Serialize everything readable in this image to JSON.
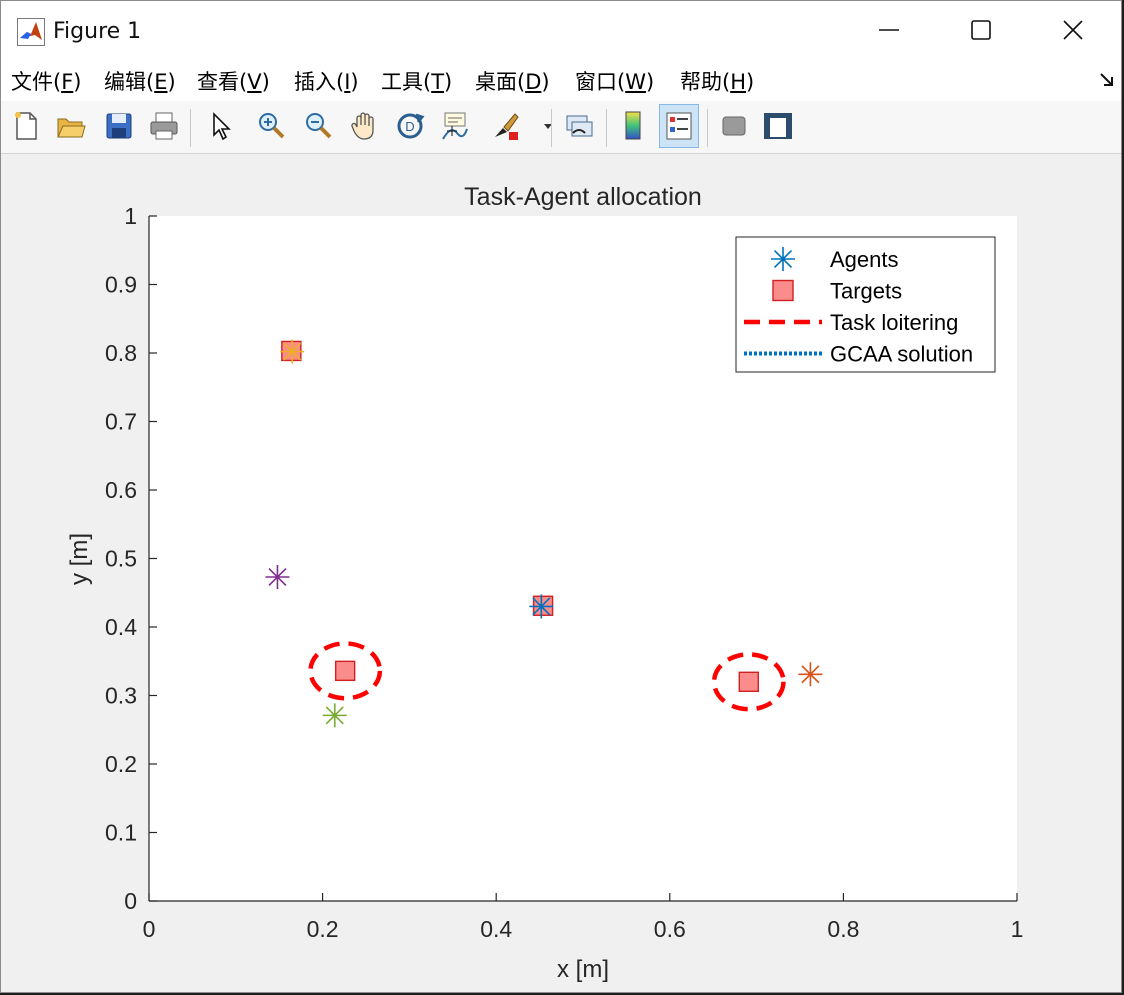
{
  "window": {
    "title": "Figure 1",
    "icon": "matlab-icon"
  },
  "controls": {
    "minimize_icon": "minimize-icon",
    "maximize_icon": "maximize-icon",
    "close_icon": "close-icon"
  },
  "menu": {
    "items": [
      "文件(F)",
      "编辑(E)",
      "查看(V)",
      "插入(I)",
      "工具(T)",
      "桌面(D)",
      "窗口(W)",
      "帮助(H)"
    ],
    "mnemonics": [
      "F",
      "E",
      "V",
      "I",
      "T",
      "D",
      "W",
      "H"
    ],
    "corner_icon": "dock-arrow-icon"
  },
  "toolbar": {
    "buttons": [
      "new-figure-icon",
      "open-file-icon",
      "save-icon",
      "print-icon",
      "pointer-icon",
      "zoom-in-icon",
      "zoom-out-icon",
      "pan-icon",
      "rotate-3d-icon",
      "data-cursor-icon",
      "brush-icon",
      "brush-dropdown-icon",
      "link-plot-icon",
      "colorbar-icon",
      "legend-icon",
      "hide-plot-tools-icon",
      "show-plot-tools-icon"
    ],
    "active": "legend-icon"
  },
  "chart_data": {
    "type": "scatter",
    "title": "Task-Agent allocation",
    "xlabel": "x [m]",
    "ylabel": "y [m]",
    "xlim": [
      0,
      1
    ],
    "ylim": [
      0,
      1
    ],
    "xticks": [
      "0",
      "0.2",
      "0.4",
      "0.6",
      "0.8",
      "1"
    ],
    "yticks": [
      "0",
      "0.1",
      "0.2",
      "0.3",
      "0.4",
      "0.5",
      "0.6",
      "0.7",
      "0.8",
      "0.9",
      "1"
    ],
    "grid": false,
    "legend_position": "top-right",
    "legend": [
      {
        "label": "Agents",
        "marker": "asterisk",
        "color": "#0072BD"
      },
      {
        "label": "Targets",
        "marker": "square",
        "color": "#FA8C8C"
      },
      {
        "label": "Task loitering",
        "line": "dashed",
        "color": "#FF0000"
      },
      {
        "label": "GCAA solution",
        "line": "dotted",
        "color": "#0072BD"
      }
    ],
    "agents": [
      {
        "x": 0.165,
        "y": 0.802,
        "color": "#EDB120"
      },
      {
        "x": 0.148,
        "y": 0.473,
        "color": "#7E2F8E"
      },
      {
        "x": 0.452,
        "y": 0.43,
        "color": "#0072BD"
      },
      {
        "x": 0.214,
        "y": 0.271,
        "color": "#77AC30"
      },
      {
        "x": 0.762,
        "y": 0.331,
        "color": "#D95319"
      }
    ],
    "targets": [
      {
        "x": 0.164,
        "y": 0.803
      },
      {
        "x": 0.454,
        "y": 0.431
      },
      {
        "x": 0.226,
        "y": 0.336
      },
      {
        "x": 0.691,
        "y": 0.32
      }
    ],
    "loiter_circles": [
      {
        "x": 0.226,
        "y": 0.336,
        "radius": 0.04
      },
      {
        "x": 0.691,
        "y": 0.32,
        "radius": 0.04
      }
    ]
  }
}
